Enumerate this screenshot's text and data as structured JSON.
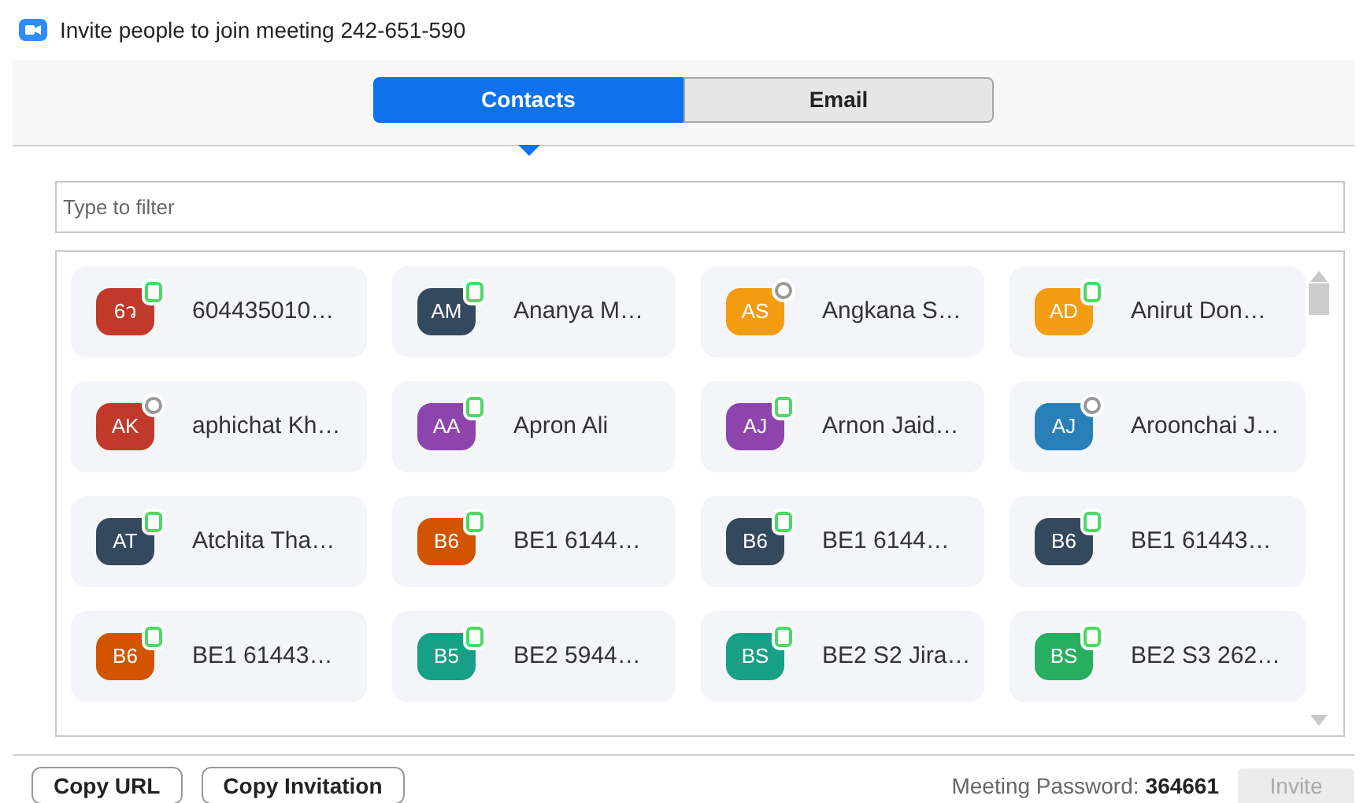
{
  "window": {
    "title": "Invite people to join meeting 242-651-590"
  },
  "tabs": [
    {
      "label": "Contacts",
      "selected": true
    },
    {
      "label": "Email",
      "selected": false
    }
  ],
  "filter": {
    "placeholder": "Type to filter"
  },
  "contacts": [
    {
      "initials": "6ว",
      "name": "604435010…",
      "color": "#c0392b",
      "online": true
    },
    {
      "initials": "AM",
      "name": "Ananya M…",
      "color": "#34495e",
      "online": true
    },
    {
      "initials": "AS",
      "name": "Angkana S…",
      "color": "#f39c12",
      "online": false
    },
    {
      "initials": "AD",
      "name": "Anirut Don…",
      "color": "#f39c12",
      "online": true
    },
    {
      "initials": "AK",
      "name": "aphichat Kh…",
      "color": "#c0392b",
      "online": false
    },
    {
      "initials": "AA",
      "name": "Apron Ali",
      "color": "#8e44ad",
      "online": true
    },
    {
      "initials": "AJ",
      "name": "Arnon Jaid…",
      "color": "#8e44ad",
      "online": true
    },
    {
      "initials": "AJ",
      "name": "Aroonchai J…",
      "color": "#2980b9",
      "online": false
    },
    {
      "initials": "AT",
      "name": "Atchita Tha…",
      "color": "#34495e",
      "online": true
    },
    {
      "initials": "B6",
      "name": "BE1 6144…",
      "color": "#d35400",
      "online": true
    },
    {
      "initials": "B6",
      "name": "BE1 6144…",
      "color": "#34495e",
      "online": true
    },
    {
      "initials": "B6",
      "name": "BE1 61443…",
      "color": "#34495e",
      "online": true
    },
    {
      "initials": "B6",
      "name": "BE1 61443…",
      "color": "#d35400",
      "online": true
    },
    {
      "initials": "B5",
      "name": "BE2 5944…",
      "color": "#16a085",
      "online": true
    },
    {
      "initials": "BS",
      "name": "BE2 S2 Jira…",
      "color": "#16a085",
      "online": true
    },
    {
      "initials": "BS",
      "name": "BE2 S3 262…",
      "color": "#27ae60",
      "online": true
    }
  ],
  "footer": {
    "buttons": [
      "Copy URL",
      "Copy Invitation"
    ],
    "password_label": "Meeting Password:",
    "password": "364661",
    "invite": {
      "label": "Invite",
      "disabled": true
    }
  }
}
